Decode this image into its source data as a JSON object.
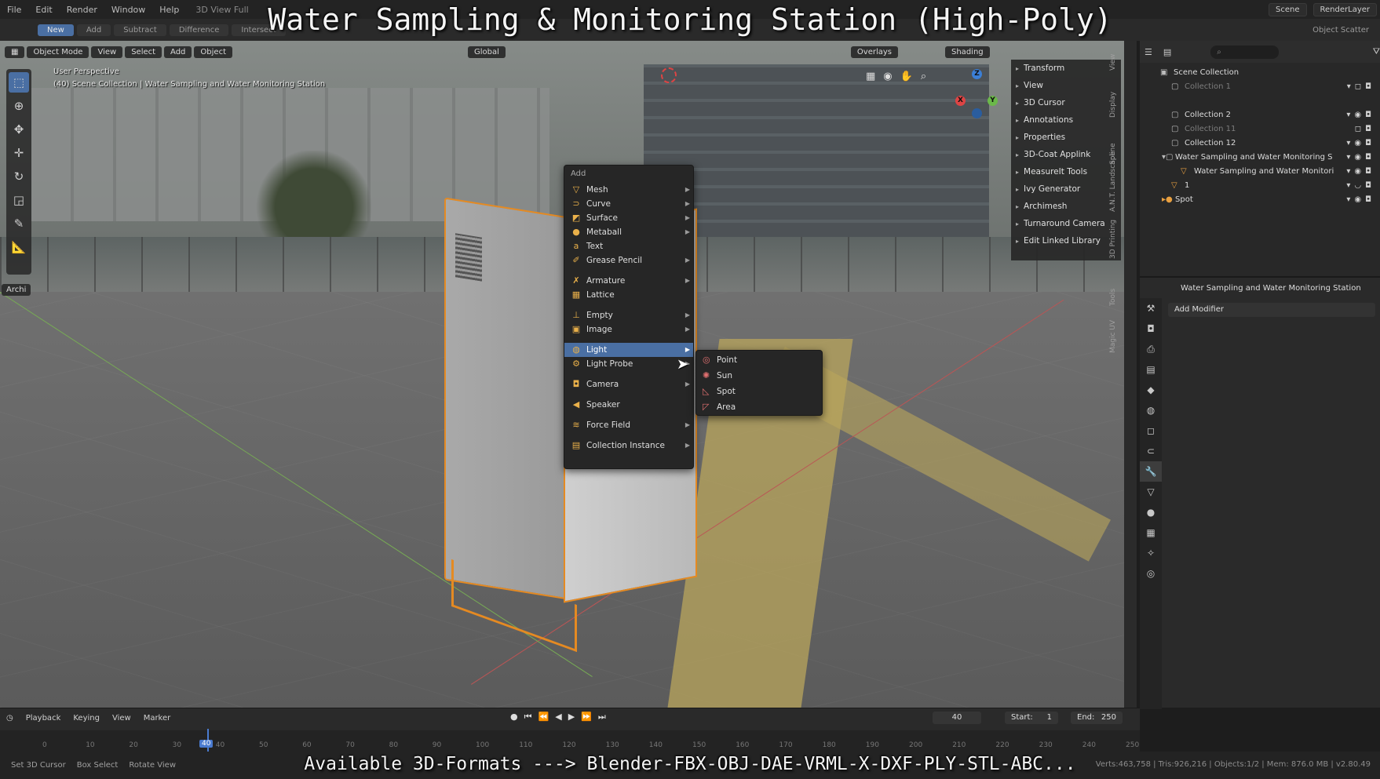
{
  "overlay": {
    "title": "Water Sampling & Monitoring Station (High-Poly)",
    "bottom_banner": "Available 3D-Formats ---> Blender-FBX-OBJ-DAE-VRML-X-DXF-PLY-STL-ABC..."
  },
  "topbar": {
    "menus": [
      "File",
      "Edit",
      "Render",
      "Window",
      "Help"
    ],
    "workspace": "3D View Full",
    "scene": "Scene",
    "view_layer": "RenderLayer"
  },
  "toolrow": {
    "buttons": [
      "New",
      "Add",
      "Subtract",
      "Difference",
      "Intersect"
    ],
    "object_scatter": "Object Scatter"
  },
  "viewport_header": {
    "mode": "Object Mode",
    "menus": [
      "View",
      "Select",
      "Add",
      "Object"
    ],
    "orientation": "Global",
    "overlays": "Overlays",
    "shading": "Shading"
  },
  "viewport": {
    "perspective": "User Perspective",
    "collection_path": "(40) Scene Collection | Water Sampling and Water Monitoring Station",
    "archi_tab": "Archi"
  },
  "npanel": {
    "items": [
      "Transform",
      "View",
      "3D Cursor",
      "Annotations",
      "Properties",
      "3D-Coat Applink",
      "MeasureIt Tools",
      "Ivy Generator",
      "Archimesh",
      "Turnaround Camera",
      "Edit Linked Library"
    ],
    "tabs": [
      "View",
      "Display",
      "Spline",
      "A.N.T. Landscape",
      "3D Printing",
      "Tools",
      "Magic UV"
    ]
  },
  "add_menu": {
    "title": "Add",
    "items": [
      {
        "label": "Mesh",
        "icon": "mesh-icon"
      },
      {
        "label": "Curve",
        "icon": "curve-icon"
      },
      {
        "label": "Surface",
        "icon": "surface-icon"
      },
      {
        "label": "Metaball",
        "icon": "metaball-icon"
      },
      {
        "label": "Text",
        "icon": "text-icon"
      },
      {
        "label": "Grease Pencil",
        "icon": "grease-pencil-icon"
      },
      {
        "label": "Armature",
        "icon": "armature-icon"
      },
      {
        "label": "Lattice",
        "icon": "lattice-icon"
      },
      {
        "label": "Empty",
        "icon": "empty-icon"
      },
      {
        "label": "Image",
        "icon": "image-icon"
      },
      {
        "label": "Light",
        "icon": "light-icon"
      },
      {
        "label": "Light Probe",
        "icon": "light-probe-icon"
      },
      {
        "label": "Camera",
        "icon": "camera-icon"
      },
      {
        "label": "Speaker",
        "icon": "speaker-icon"
      },
      {
        "label": "Force Field",
        "icon": "force-field-icon"
      },
      {
        "label": "Collection Instance",
        "icon": "collection-instance-icon"
      }
    ]
  },
  "light_submenu": {
    "items": [
      "Point",
      "Sun",
      "Spot",
      "Area"
    ]
  },
  "outliner": {
    "items": [
      {
        "label": "Scene Collection"
      },
      {
        "label": "Collection 1"
      },
      {
        "label": "Collection 2"
      },
      {
        "label": "Collection 11"
      },
      {
        "label": "Collection 12"
      },
      {
        "label": "Water Sampling and Water Monitoring S"
      },
      {
        "label": "Water Sampling and Water Monitori"
      },
      {
        "label": "1"
      },
      {
        "label": "Spot"
      }
    ]
  },
  "properties": {
    "object_name": "Water Sampling and Water Monitoring Station",
    "add_modifier": "Add Modifier"
  },
  "timeline": {
    "menus": [
      "Playback",
      "Keying",
      "View",
      "Marker"
    ],
    "current_frame": "40",
    "start_label": "Start:",
    "start": "1",
    "end_label": "End:",
    "end": "250",
    "ticks": [
      "0",
      "10",
      "20",
      "30",
      "40",
      "50",
      "60",
      "70",
      "80",
      "90",
      "100",
      "110",
      "120",
      "130",
      "140",
      "150",
      "160",
      "170",
      "180",
      "190",
      "200",
      "210",
      "220",
      "230",
      "240",
      "250"
    ]
  },
  "statusbar": {
    "left1": "Set 3D Cursor",
    "left2": "Box Select",
    "left3": "Rotate View",
    "stats": "Verts:463,758 | Tris:926,216 | Objects:1/2 | Mem: 876.0 MB | v2.80.49"
  }
}
